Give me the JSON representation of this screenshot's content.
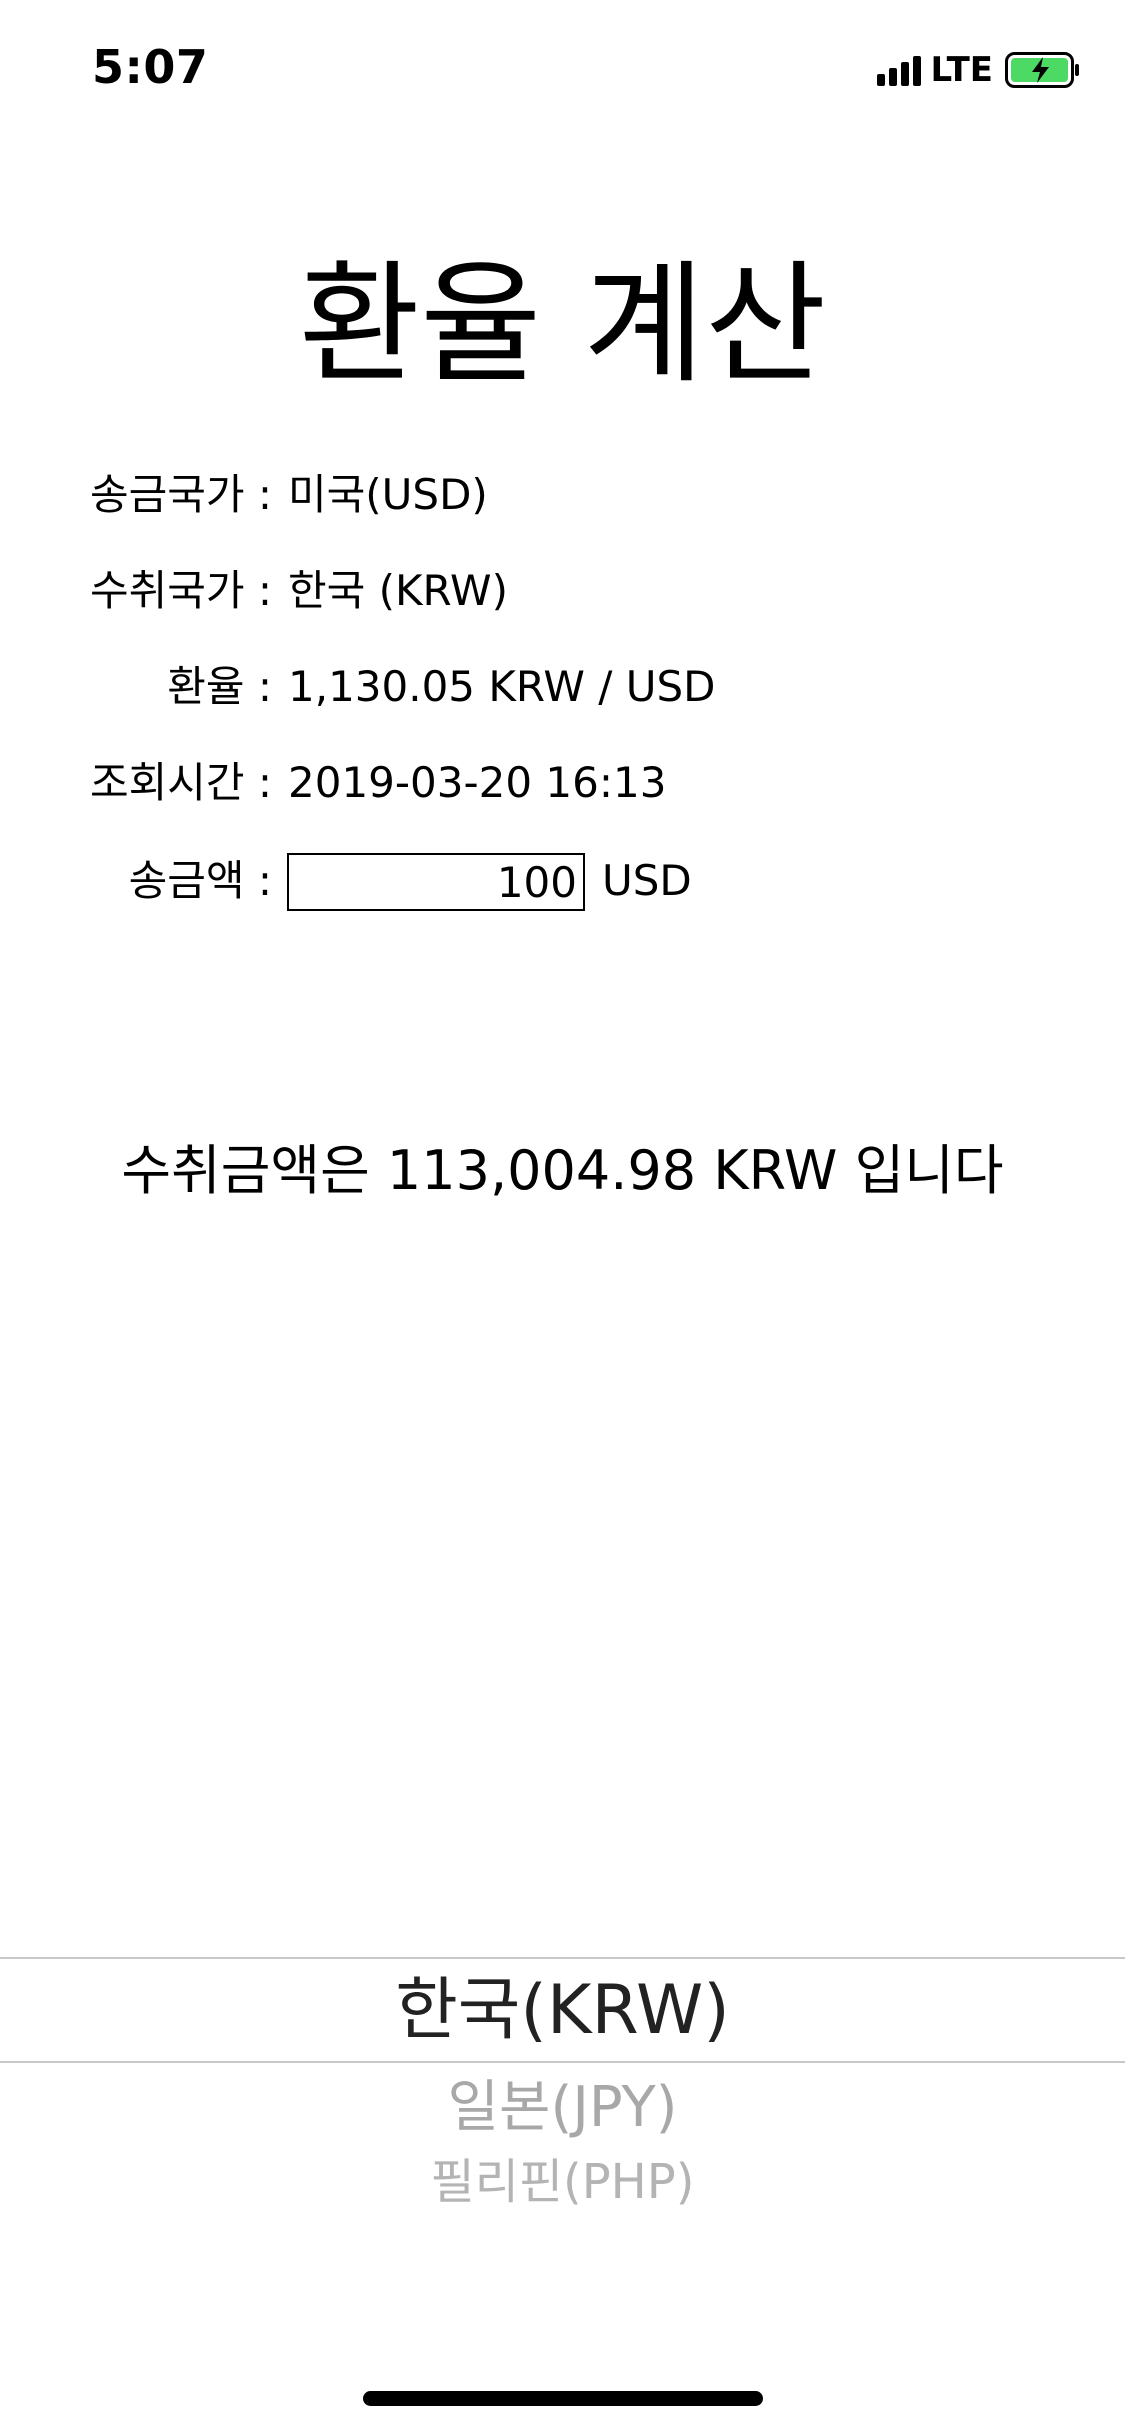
{
  "status_bar": {
    "time": "5:07",
    "network": "LTE",
    "signal_icon": "cellular-signal-icon",
    "battery_icon": "battery-charging-icon",
    "battery_color": "#4cd964"
  },
  "title": "환율 계산",
  "info": {
    "send_country_label": "송금국가 :",
    "send_country_value": "미국(USD)",
    "receive_country_label": "수취국가 :",
    "receive_country_value": "한국 (KRW)",
    "rate_label": "환율 :",
    "rate_value": "1,130.05 KRW / USD",
    "query_time_label": "조회시간 :",
    "query_time_value": "2019-03-20 16:13",
    "amount_label": "송금액 :",
    "amount_value": "100",
    "amount_unit": "USD"
  },
  "result": {
    "text": "수취금액은 113,004.98 KRW 입니다"
  },
  "picker": {
    "selected": "한국(KRW)",
    "options_below": [
      "일본(JPY)",
      "필리핀(PHP)"
    ]
  }
}
